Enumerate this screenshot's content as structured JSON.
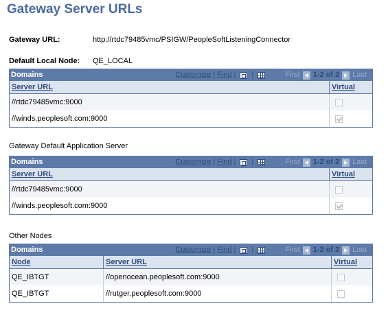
{
  "page": {
    "title": "Gateway Server URLs",
    "gateway_url_label": "Gateway URL:",
    "gateway_url_value": "http://rtdc79485vmc/PSIGW/PeopleSoftListeningConnector",
    "default_node_label": "Default Local Node:",
    "default_node_value": "QE_LOCAL"
  },
  "nav": {
    "customize": "Customize",
    "find": "Find",
    "sep": "|",
    "first": "First",
    "count": "1-2 of 2",
    "last": "Last"
  },
  "grid1": {
    "title": "Domains",
    "columns": [
      "Server URL",
      "Virtual"
    ],
    "rows": [
      {
        "url": "//rtdc79485vmc:9000",
        "virtual": false
      },
      {
        "url": "//winds.peoplesoft.com:9000",
        "virtual": true
      }
    ]
  },
  "section2": {
    "label": "Gateway Default Application Server"
  },
  "grid2": {
    "title": "Domains",
    "columns": [
      "Server URL",
      "Virtual"
    ],
    "rows": [
      {
        "url": "//rtdc79485vmc:9000",
        "virtual": false
      },
      {
        "url": "//winds.peoplesoft.com:9000",
        "virtual": true
      }
    ]
  },
  "section3": {
    "label": "Other Nodes"
  },
  "grid3": {
    "title": "Domains",
    "columns": [
      "Node",
      "Server URL",
      "Virtual"
    ],
    "rows": [
      {
        "node": "QE_IBTGT",
        "url": "//openocean.peoplesoft.com:9000",
        "virtual": false
      },
      {
        "node": "QE_IBTGT",
        "url": "//rutger.peoplesoft.com:9000",
        "virtual": false
      }
    ]
  },
  "colors": {
    "title": "#4a6a9f",
    "grid_header": "#5d7aa8",
    "column_header_bg": "#dbe3ef",
    "link": "#2d4c7e"
  }
}
